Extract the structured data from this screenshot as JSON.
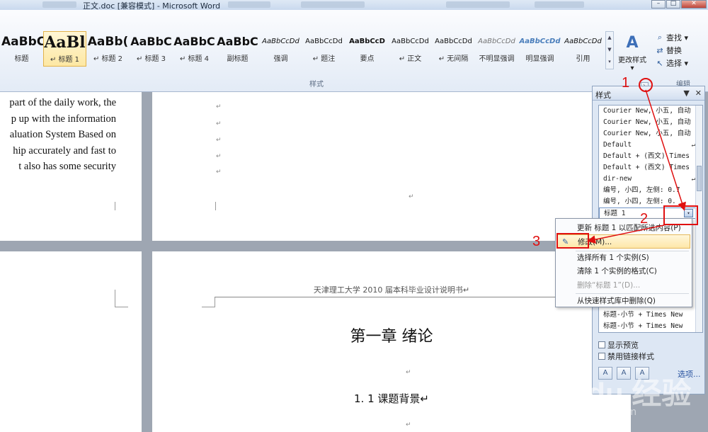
{
  "titlebar": {
    "title": "正文.doc [兼容模式] - Microsoft Word",
    "minimize": "–",
    "maximize": "□",
    "close": "✕"
  },
  "ribbon": {
    "styles_group_label": "样式",
    "editing_group_label": "编辑",
    "gallery": [
      {
        "preview": "AaBbC",
        "label": "标题"
      },
      {
        "preview": "AaBl",
        "label": "↵ 标题 1"
      },
      {
        "preview": "AaBb(",
        "label": "↵ 标题 2"
      },
      {
        "preview": "AaBbC",
        "label": "↵ 标题 3"
      },
      {
        "preview": "AaBbC",
        "label": "↵ 标题 4"
      },
      {
        "preview": "AaBbC",
        "label": "副标题"
      },
      {
        "preview": "AaBbCcDd",
        "label": "强调"
      },
      {
        "preview": "AaBbCcDd",
        "label": "↵ 题注"
      },
      {
        "preview": "AaBbCcD",
        "label": "要点"
      },
      {
        "preview": "AaBbCcDd",
        "label": "↵ 正文"
      },
      {
        "preview": "AaBbCcDd",
        "label": "↵ 无间隔"
      },
      {
        "preview": "AaBbCcDd",
        "label": "不明显强调"
      },
      {
        "preview": "AaBbCcDd",
        "label": "明显强调"
      },
      {
        "preview": "AaBbCcDd",
        "label": "引用"
      }
    ],
    "change_styles_label": "更改样式",
    "change_styles_arrow": "▾",
    "find_label": "查找 ▾",
    "replace_label": "替换",
    "select_label": "选择 ▾",
    "scroll_up": "▲",
    "scroll_down": "▼",
    "scroll_more": "▾",
    "launcher": "↘"
  },
  "document": {
    "english_lines": [
      "part of the daily work, the",
      "p up with the information",
      "aluation System Based on",
      "hip accurately and fast to",
      "t also has some security"
    ],
    "para_mark": "↵",
    "header_text": "天津理工大学 2010 届本科毕业设计说明书↵",
    "chapter_title": "第一章  绪论",
    "section_title": "1. 1 课题背景↵"
  },
  "styles_pane": {
    "title": "样式",
    "dropdown_glyph": "▼",
    "close_glyph": "✕",
    "items": [
      {
        "label": "Courier New, 小五, 自动",
        "symbol": ""
      },
      {
        "label": "Courier New, 小五, 自动",
        "symbol": ""
      },
      {
        "label": "Courier New, 小五, 自动",
        "symbol": ""
      },
      {
        "label": "Default",
        "symbol": "↵"
      },
      {
        "label": "Default + (西文) Times",
        "symbol": ""
      },
      {
        "label": "Default + (西文) Times",
        "symbol": ""
      },
      {
        "label": "dir-new",
        "symbol": "↵"
      },
      {
        "label": "编号, 小四, 左侧: 0.7",
        "symbol": ""
      },
      {
        "label": "编号, 小四, 左侧: 0.",
        "symbol": ""
      },
      {
        "label": "标题 1",
        "symbol": ""
      }
    ],
    "bottom_items": [
      {
        "label": "标题-小节 + Times New"
      },
      {
        "label": "标题-小节 + Times New"
      }
    ],
    "selected_dropdown": "▾",
    "show_preview_label": "显示预览",
    "disable_linked_label": "禁用链接样式",
    "btn_new_style": "A",
    "btn_inspector": "A",
    "btn_manage": "A",
    "options_label": "选项..."
  },
  "context_menu": {
    "items": [
      {
        "label": "更新 标题 1 以匹配所选内容(P)",
        "icon": ""
      },
      {
        "label": "修改(M)...",
        "icon": "✎"
      },
      {
        "label": "选择所有 1 个实例(S)",
        "icon": ""
      },
      {
        "label": "清除 1 个实例的格式(C)",
        "icon": ""
      },
      {
        "label": "删除“标题 1”(D)...",
        "icon": ""
      },
      {
        "label": "从快速样式库中删除(Q)",
        "icon": ""
      }
    ]
  },
  "annotations": {
    "step1": "1",
    "step2": "2",
    "step3": "3",
    "color": "#e01010"
  },
  "watermark": {
    "logo": "Baidu 经验",
    "url": "jingyan.baidu.com"
  },
  "colors": {
    "ribbon_bg": "#e3ebf6",
    "doc_bg": "#9ea6b2",
    "highlight": "#fde7a8",
    "accent": "#2a54a0"
  }
}
